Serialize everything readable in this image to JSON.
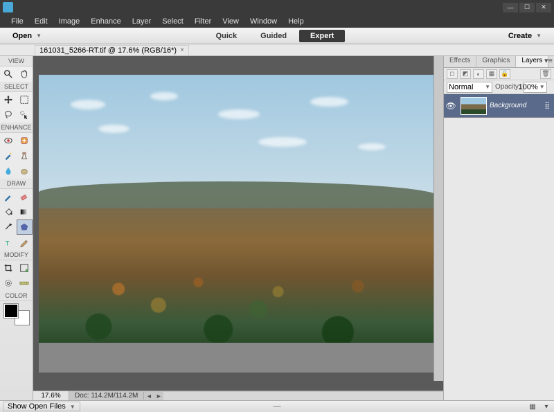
{
  "menubar": [
    "File",
    "Edit",
    "Image",
    "Enhance",
    "Layer",
    "Select",
    "Filter",
    "View",
    "Window",
    "Help"
  ],
  "toolbar": {
    "open_label": "Open",
    "create_label": "Create"
  },
  "modes": {
    "items": [
      "Quick",
      "Guided",
      "Expert"
    ],
    "active": "Expert"
  },
  "document": {
    "tab_label": "161031_5266-RT.tif @ 17.6% (RGB/16*)",
    "zoom": "17.6%",
    "doc_size": "Doc: 114.2M/114.2M"
  },
  "tool_sections": {
    "view": "VIEW",
    "select": "SELECT",
    "enhance": "ENHANCE",
    "draw": "DRAW",
    "modify": "MODIFY",
    "color": "COLOR"
  },
  "right_panel": {
    "tabs": [
      "Effects",
      "Graphics",
      "Layers"
    ],
    "active": "Layers",
    "blend_mode": "Normal",
    "opacity_label": "Opacity:",
    "opacity_value": "100%",
    "layers": [
      {
        "name": "Background",
        "visible": true,
        "locked": true
      }
    ]
  },
  "bottombar": {
    "show_open_files": "Show Open Files"
  }
}
